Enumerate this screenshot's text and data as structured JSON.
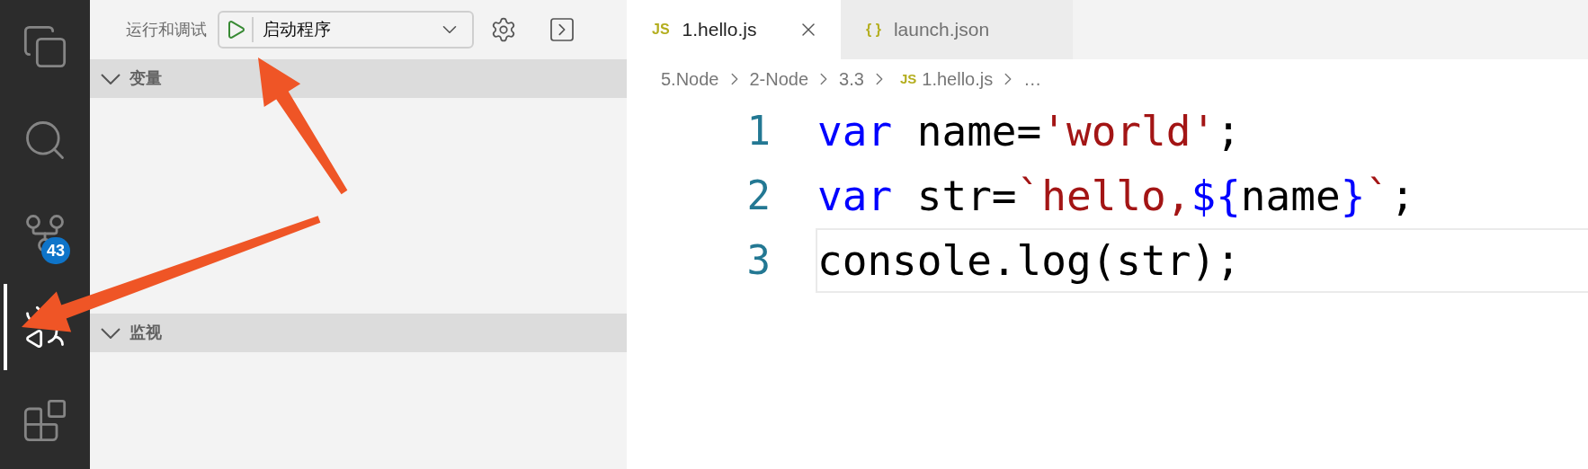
{
  "activity_bar": [
    {
      "kind": "files",
      "selected": false
    },
    {
      "kind": "search",
      "selected": false
    },
    {
      "kind": "source_control",
      "selected": false,
      "badge": "43"
    },
    {
      "kind": "debug",
      "selected": true
    },
    {
      "kind": "extensions",
      "selected": false
    }
  ],
  "sidebar": {
    "title": "运行和调试",
    "config": "启动程序",
    "sections": [
      {
        "title": "变量",
        "expanded": true
      },
      {
        "title": "监视",
        "expanded": true
      }
    ]
  },
  "tabs": [
    {
      "icon_text": "JS",
      "label": "1.hello.js",
      "selected": true
    },
    {
      "icon_text": "{ }",
      "label": "launch.json",
      "selected": false
    }
  ],
  "breadcrumbs": [
    {
      "label": "5.Node"
    },
    {
      "label": "2-Node"
    },
    {
      "label": "3.3"
    },
    {
      "icon_text": "JS",
      "label": "1.hello.js"
    },
    {
      "label": "…"
    }
  ],
  "code": [
    {
      "number": "1",
      "current": false,
      "tokens": [
        {
          "kind": "keyword",
          "text": "var"
        },
        {
          "kind": "plain",
          "text": " name="
        },
        {
          "kind": "string",
          "text": "'world'"
        },
        {
          "kind": "plain",
          "text": ";"
        }
      ]
    },
    {
      "number": "2",
      "current": false,
      "tokens": [
        {
          "kind": "keyword",
          "text": "var"
        },
        {
          "kind": "plain",
          "text": " str="
        },
        {
          "kind": "string",
          "text": "`hello,"
        },
        {
          "kind": "template",
          "text": "${"
        },
        {
          "kind": "plain",
          "text": "name"
        },
        {
          "kind": "template",
          "text": "}"
        },
        {
          "kind": "string",
          "text": "`"
        },
        {
          "kind": "plain",
          "text": ";"
        }
      ]
    },
    {
      "number": "3",
      "current": true,
      "tokens": [
        {
          "kind": "plain",
          "text": "console.log(str);"
        }
      ]
    }
  ],
  "annotations": [
    {
      "kind": "arrow"
    },
    {
      "kind": "arrow"
    }
  ]
}
